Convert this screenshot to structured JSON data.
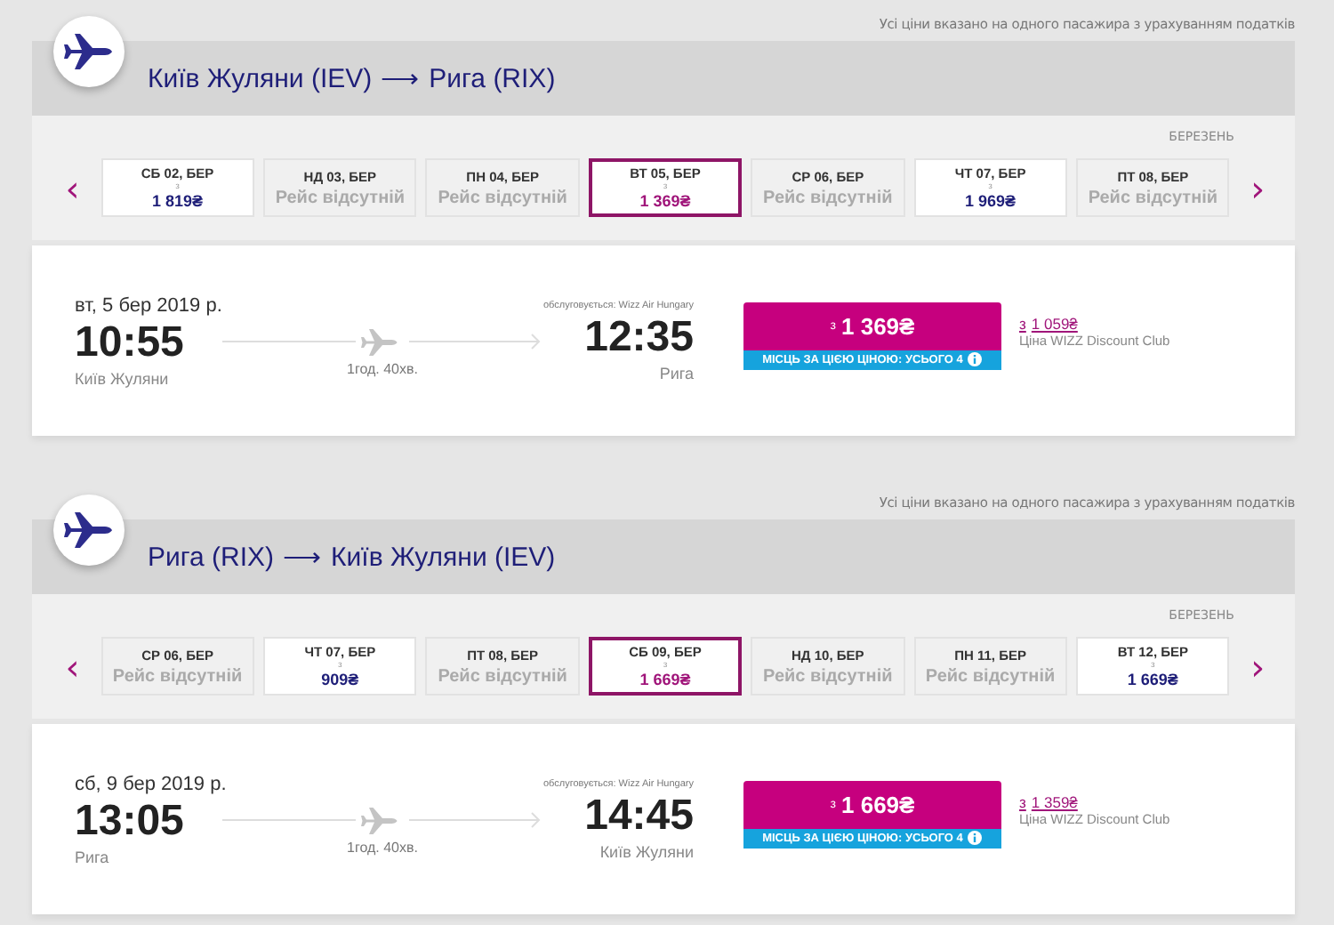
{
  "sections": [
    {
      "note": "Усі ціни вказано на одного пасажира з урахуванням податків",
      "route": {
        "from": "Київ Жуляни (IEV)",
        "arrow": "⟶",
        "to": "Рига (RIX)"
      },
      "month": "БЕРЕЗЕНЬ",
      "prev": "‹",
      "next": "›",
      "days": [
        {
          "label": "СБ 02, БЕР",
          "kind": "fare",
          "prefix": "з",
          "price": "1 819₴",
          "selected": false
        },
        {
          "label": "НД 03, БЕР",
          "kind": "none",
          "status": "Рейс відсутній",
          "selected": false
        },
        {
          "label": "ПН 04, БЕР",
          "kind": "none",
          "status": "Рейс відсутній",
          "selected": false
        },
        {
          "label": "ВТ 05, БЕР",
          "kind": "fare",
          "prefix": "з",
          "price": "1 369₴",
          "selected": true
        },
        {
          "label": "СР 06, БЕР",
          "kind": "none",
          "status": "Рейс відсутній",
          "selected": false
        },
        {
          "label": "ЧТ 07, БЕР",
          "kind": "fare",
          "prefix": "з",
          "price": "1 969₴",
          "selected": false
        },
        {
          "label": "ПТ 08, БЕР",
          "kind": "none",
          "status": "Рейс відсутній",
          "selected": false
        }
      ],
      "flight": {
        "date": "вт, 5 бер 2019 р.",
        "dep_time": "10:55",
        "dep_city": "Київ Жуляни",
        "duration": "1год. 40хв.",
        "operator": "обслуговується: Wizz Air Hungary",
        "arr_time": "12:35",
        "arr_city": "Рига",
        "fare_prefix": "з",
        "fare": "1 369₴",
        "seats": "МІСЦЬ ЗА ЦІЄЮ ЦІНОЮ: УСЬОГО 4",
        "club_prefix": "з",
        "club_price": "1 059₴",
        "club_label": "Ціна WIZZ Discount Club"
      }
    },
    {
      "note": "Усі ціни вказано на одного пасажира з урахуванням податків",
      "route": {
        "from": "Рига (RIX)",
        "arrow": "⟶",
        "to": "Київ Жуляни (IEV)"
      },
      "month": "БЕРЕЗЕНЬ",
      "prev": "‹",
      "next": "›",
      "days": [
        {
          "label": "СР 06, БЕР",
          "kind": "none",
          "status": "Рейс відсутній",
          "selected": false
        },
        {
          "label": "ЧТ 07, БЕР",
          "kind": "fare",
          "prefix": "з",
          "price": "909₴",
          "selected": false
        },
        {
          "label": "ПТ 08, БЕР",
          "kind": "none",
          "status": "Рейс відсутній",
          "selected": false
        },
        {
          "label": "СБ 09, БЕР",
          "kind": "fare",
          "prefix": "з",
          "price": "1 669₴",
          "selected": true
        },
        {
          "label": "НД 10, БЕР",
          "kind": "none",
          "status": "Рейс відсутній",
          "selected": false
        },
        {
          "label": "ПН 11, БЕР",
          "kind": "none",
          "status": "Рейс відсутній",
          "selected": false
        },
        {
          "label": "ВТ 12, БЕР",
          "kind": "fare",
          "prefix": "з",
          "price": "1 669₴",
          "selected": false
        }
      ],
      "flight": {
        "date": "сб, 9 бер 2019 р.",
        "dep_time": "13:05",
        "dep_city": "Рига",
        "duration": "1год. 40хв.",
        "operator": "обслуговується: Wizz Air Hungary",
        "arr_time": "14:45",
        "arr_city": "Київ Жуляни",
        "fare_prefix": "з",
        "fare": "1 669₴",
        "seats": "МІСЦЬ ЗА ЦІЄЮ ЦІНОЮ: УСЬОГО 4",
        "club_prefix": "з",
        "club_price": "1 359₴",
        "club_label": "Ціна WIZZ Discount Club"
      }
    }
  ]
}
